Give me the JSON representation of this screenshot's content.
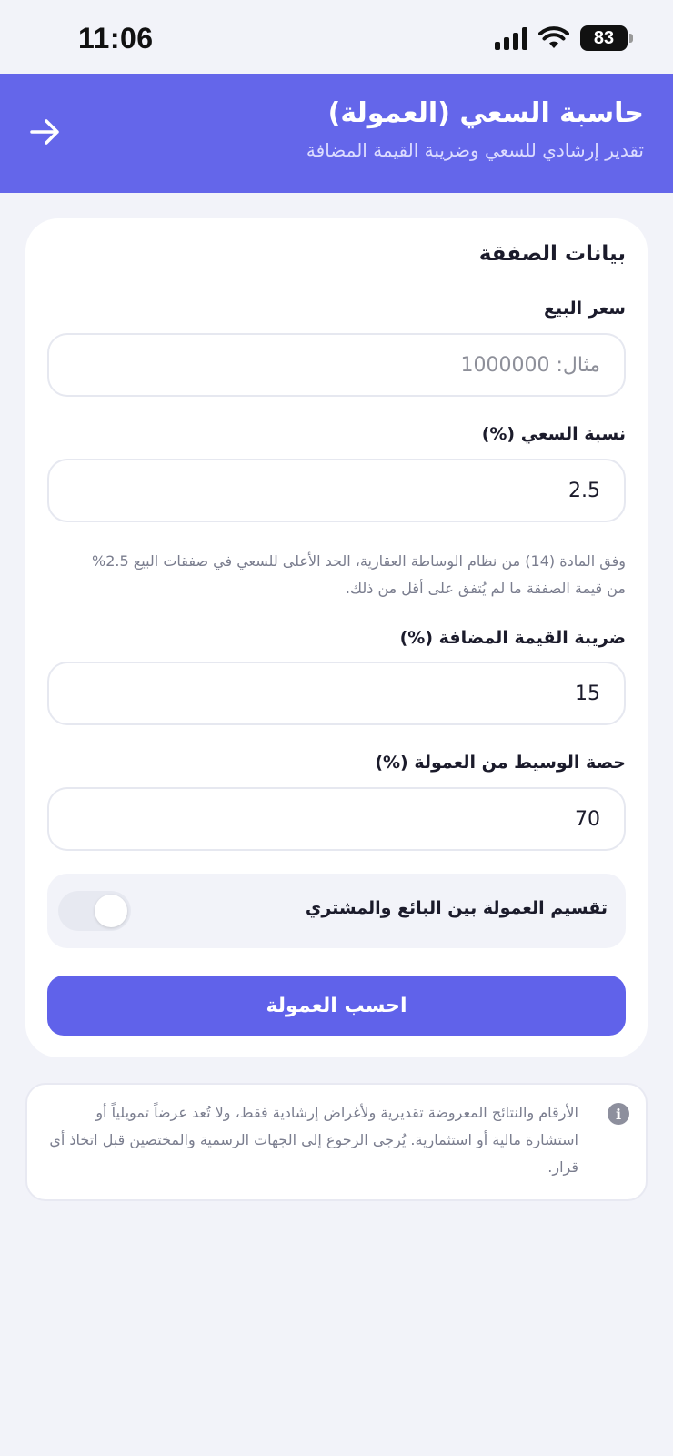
{
  "status_bar": {
    "time": "11:06",
    "battery": "83"
  },
  "header": {
    "title": "حاسبة السعي (العمولة)",
    "subtitle": "تقدير إرشادي للسعي وضريبة القيمة المضافة",
    "back_icon": "arrow-right-icon"
  },
  "form": {
    "section_title": "بيانات الصفقة",
    "sale_price": {
      "label": "سعر البيع",
      "placeholder": "مثال: 1000000",
      "value": ""
    },
    "commission_rate": {
      "label": "نسبة السعي (%)",
      "value": "2.5"
    },
    "hint": "وفق المادة (14) من نظام الوساطة العقارية، الحد الأعلى للسعي في صفقات البيع 2.5% من قيمة الصفقة ما لم يُتفق على أقل من ذلك.",
    "vat": {
      "label": "ضريبة القيمة المضافة (%)",
      "value": "15"
    },
    "broker_share": {
      "label": "حصة الوسيط من العمولة (%)",
      "value": "70"
    },
    "split_toggle": {
      "label": "تقسيم العمولة بين البائع والمشتري",
      "enabled": false
    },
    "calculate_button": "احسب العمولة"
  },
  "disclaimer": {
    "icon": "info-icon",
    "text": "الأرقام والنتائج المعروضة تقديرية ولأغراض إرشادية فقط، ولا تُعد عرضاً تمويلياً أو استشارة مالية أو استثمارية. يُرجى الرجوع إلى الجهات الرسمية والمختصين قبل اتخاذ أي قرار."
  },
  "colors": {
    "primary": "#6466ea",
    "background": "#f2f3f9",
    "muted_text": "#7a7d8e"
  }
}
